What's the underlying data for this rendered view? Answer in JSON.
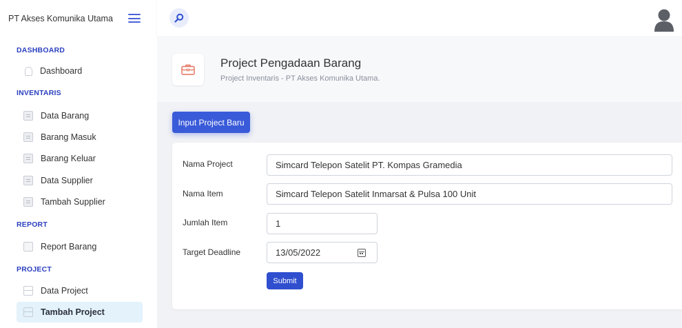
{
  "app": {
    "brand": "PT Akses Komunika Utama"
  },
  "sidebar": {
    "sections": [
      {
        "title": "DASHBOARD",
        "items": [
          {
            "label": "Dashboard"
          }
        ]
      },
      {
        "title": "INVENTARIS",
        "items": [
          {
            "label": "Data Barang"
          },
          {
            "label": "Barang Masuk"
          },
          {
            "label": "Barang Keluar"
          },
          {
            "label": "Data Supplier"
          },
          {
            "label": "Tambah Supplier"
          }
        ]
      },
      {
        "title": "REPORT",
        "items": [
          {
            "label": "Report Barang"
          }
        ]
      },
      {
        "title": "PROJECT",
        "items": [
          {
            "label": "Data Project"
          },
          {
            "label": "Tambah Project",
            "active": true
          }
        ]
      }
    ]
  },
  "header": {
    "title": "Project Pengadaan Barang",
    "subtitle": "Project Inventaris - PT Akses Komunika Utama."
  },
  "actions": {
    "new_project": "Input Project Baru"
  },
  "form": {
    "fields": [
      {
        "label": "Nama Project",
        "value": "Simcard Telepon Satelit PT. Kompas Gramedia"
      },
      {
        "label": "Nama Item",
        "value": "Simcard Telepon Satelit Inmarsat & Pulsa 100 Unit"
      },
      {
        "label": "Jumlah Item",
        "value": "1"
      },
      {
        "label": "Target Deadline",
        "value": "13/05/2022"
      }
    ],
    "submit": "Submit"
  },
  "icons": {
    "menu": "hamburger-icon",
    "search": "search-icon",
    "user": "user-avatar-icon",
    "header": "briefcase-icon",
    "calendar": "calendar-icon"
  },
  "colors": {
    "accent": "#3a5bd9",
    "section_title": "#2a3fbf",
    "active_bg": "#e3f2fb"
  }
}
